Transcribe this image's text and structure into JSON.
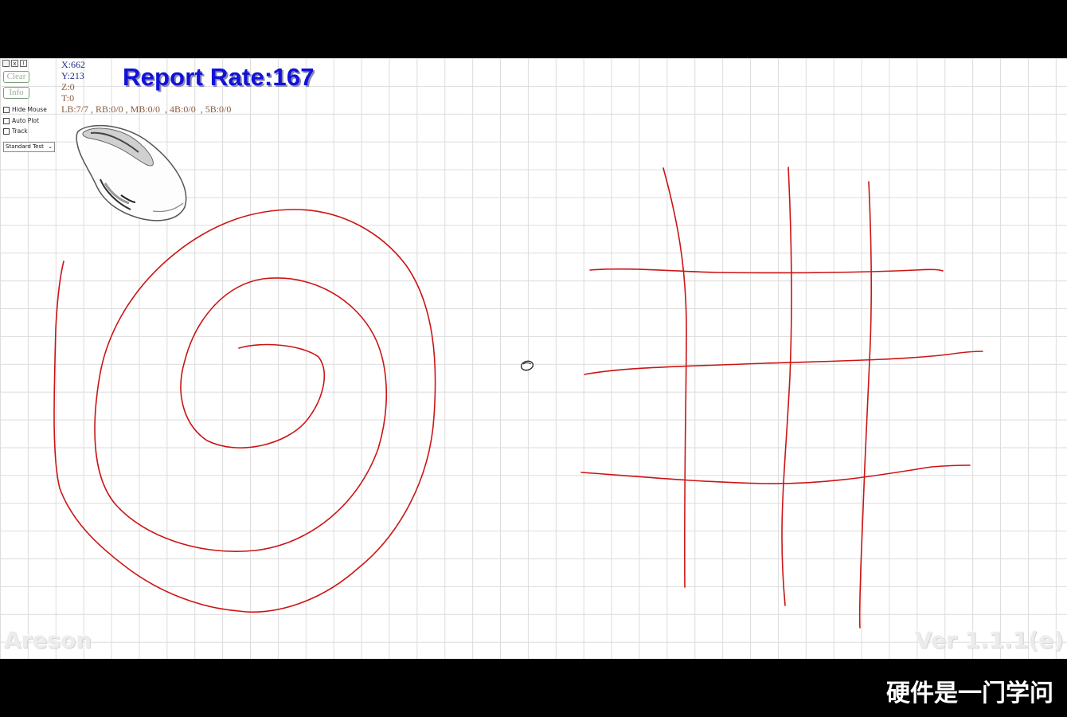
{
  "window_controls": [
    "_",
    "x",
    "!"
  ],
  "sidebar": {
    "clear_label": "Clear",
    "info_label": "Info",
    "hide_mouse_label": "Hide Mouse",
    "auto_plot_label": "Auto Plot",
    "track_label": "Track",
    "test_mode": "Standard Test"
  },
  "readout": {
    "x": "X:662",
    "y": "Y:213",
    "z": "Z:0",
    "t": "T:0",
    "buttons": "LB:7/7 , RB:0/0 , MB:0/0  , 4B:0/0  , 5B:0/0"
  },
  "report_rate": "Report Rate:167",
  "watermark_left": "Areson",
  "watermark_right": "Ver 1.1.1(e)",
  "caption": "硬件是一门学问",
  "colors": {
    "stroke": "#cc1414",
    "report_text": "#1212d8",
    "coords_xy": "#1f2a8c",
    "coords_zt": "#8a5a3a"
  },
  "icons": [
    "mouse-illustration-icon",
    "mouse-cursor-icon",
    "chevron-down-icon"
  ]
}
